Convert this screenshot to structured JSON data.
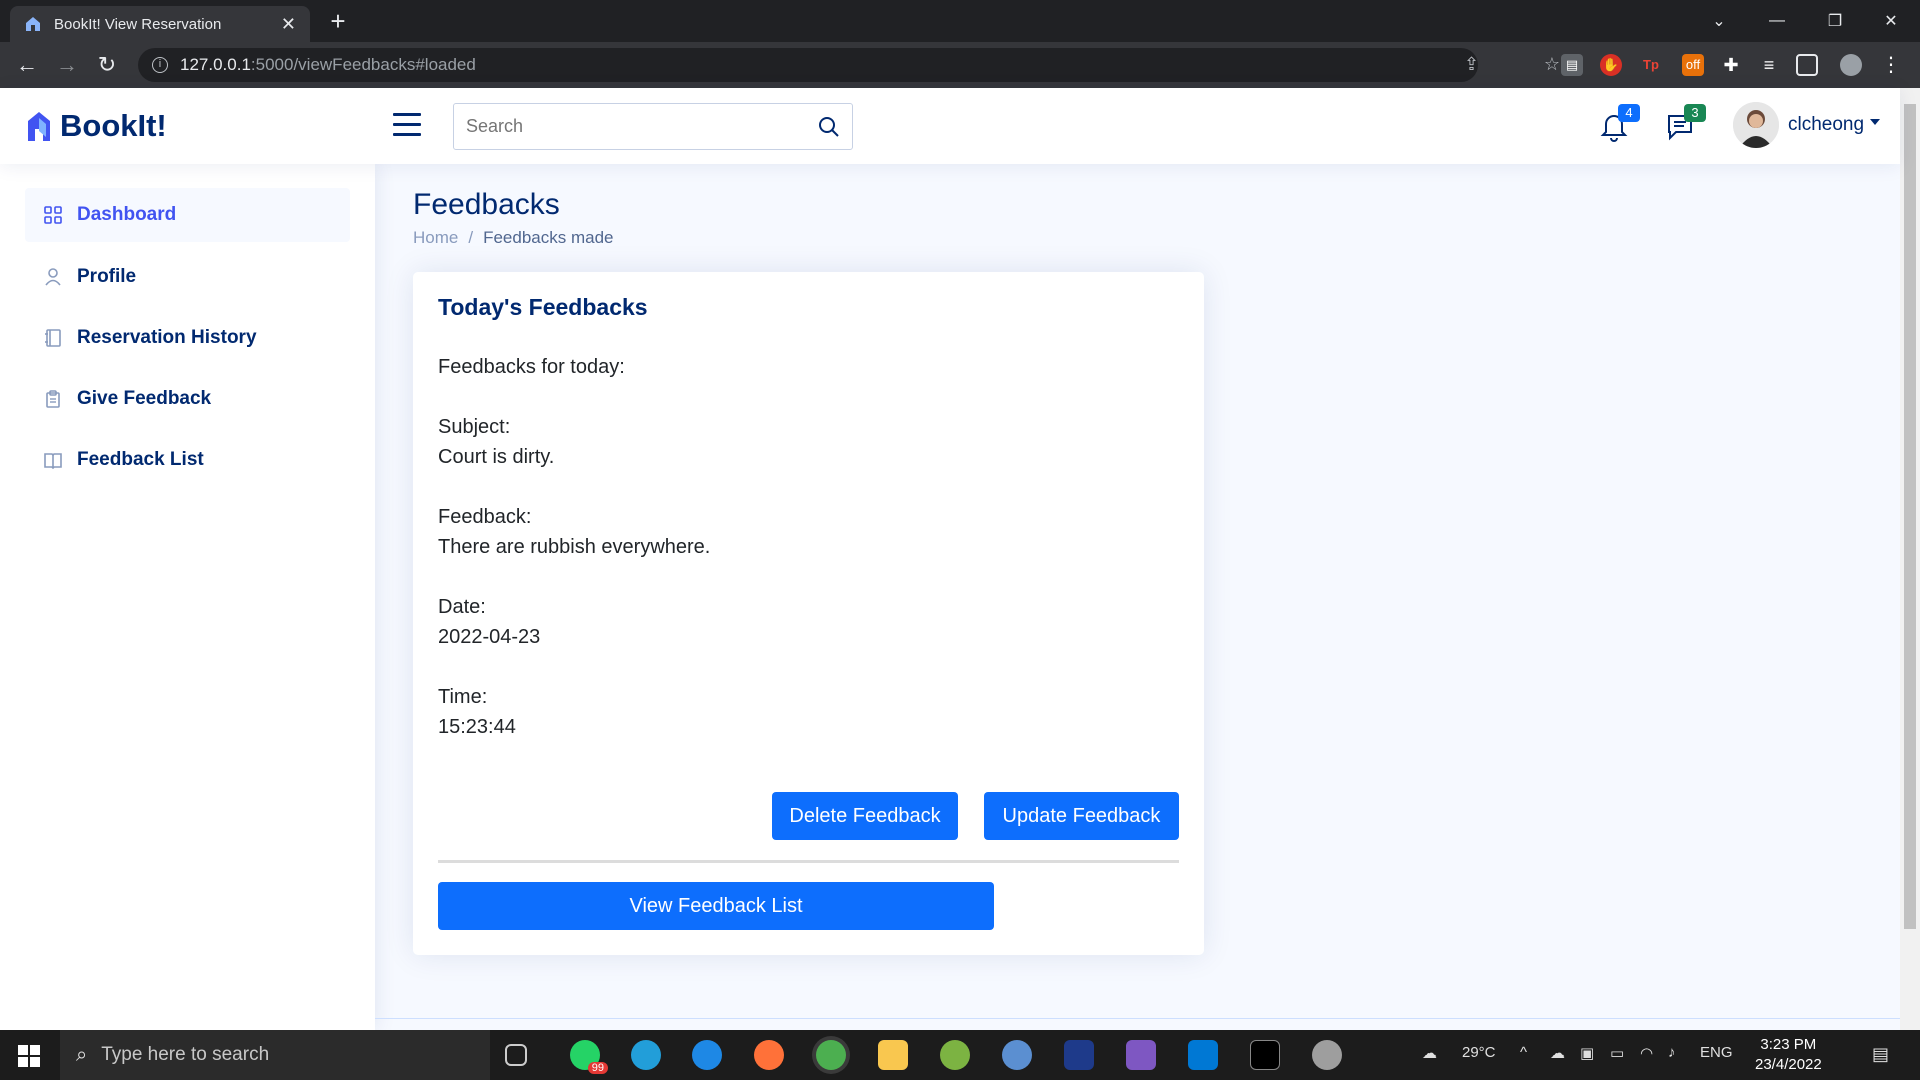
{
  "browser": {
    "tab_title": "BookIt! View Reservation",
    "url_host": "127.0.0.1",
    "url_path": ":5000/viewFeedbacks#loaded"
  },
  "header": {
    "logo_text": "BookIt!",
    "search_placeholder": "Search",
    "notifications_count": "4",
    "messages_count": "3",
    "username": "clcheong"
  },
  "sidebar": {
    "items": [
      {
        "label": "Dashboard",
        "icon": "grid-icon"
      },
      {
        "label": "Profile",
        "icon": "person-icon"
      },
      {
        "label": "Reservation History",
        "icon": "journal-icon"
      },
      {
        "label": "Give Feedback",
        "icon": "clipboard-icon"
      },
      {
        "label": "Feedback List",
        "icon": "book-icon"
      }
    ]
  },
  "page": {
    "title": "Feedbacks",
    "breadcrumb_home": "Home",
    "breadcrumb_current": "Feedbacks made"
  },
  "card": {
    "title": "Today's Feedbacks",
    "intro": "Feedbacks for today:",
    "subject_label": "Subject:",
    "subject_value": "Court is dirty.",
    "feedback_label": "Feedback:",
    "feedback_value": "There are rubbish everywhere.",
    "date_label": "Date:",
    "date_value": "2022-04-23",
    "time_label": "Time:",
    "time_value": "15:23:44",
    "delete_button": "Delete Feedback",
    "update_button": "Update Feedback",
    "view_list_button": "View Feedback List"
  },
  "taskbar": {
    "search_placeholder": "Type here to search",
    "whatsapp_badge": "99",
    "temperature": "29°C",
    "language": "ENG",
    "time": "3:23 PM",
    "date": "23/4/2022"
  },
  "colors": {
    "primary": "#0d6efd",
    "brand_navy": "#012970",
    "active_nav": "#4154f1",
    "notification_badge": "#0d6efd",
    "message_badge": "#198754"
  }
}
